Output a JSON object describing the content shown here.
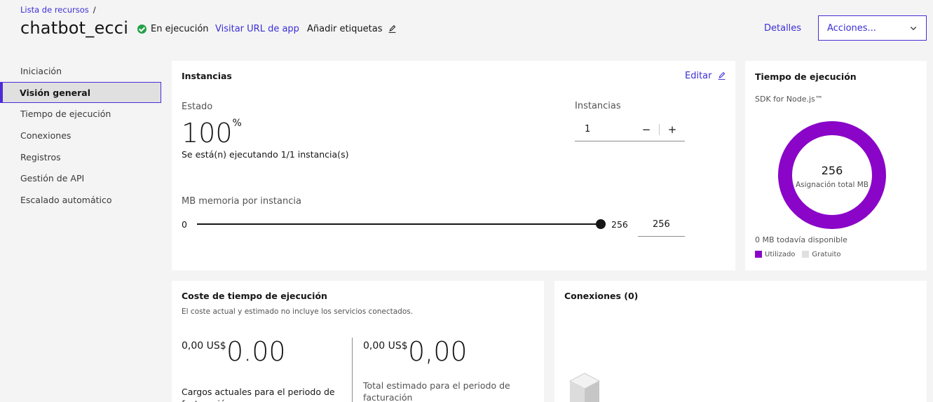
{
  "header": {
    "breadcrumb": "Lista de recursos",
    "breadcrumb_sep": "/",
    "app_name": "chatbot_ecci",
    "status": "En ejecución",
    "visit_url": "Visitar URL de app",
    "add_tags": "Añadir etiquetas",
    "details": "Detalles",
    "actions": "Acciones..."
  },
  "sidebar": {
    "items": [
      {
        "label": "Iniciación"
      },
      {
        "label": "Visión general"
      },
      {
        "label": "Tiempo de ejecución"
      },
      {
        "label": "Conexiones"
      },
      {
        "label": "Registros"
      },
      {
        "label": "Gestión de API"
      },
      {
        "label": "Escalado automático"
      }
    ],
    "active_index": 1
  },
  "instances_card": {
    "title": "Instancias",
    "edit": "Editar",
    "state_label": "Estado",
    "state_value": "100",
    "state_unit": "%",
    "state_detail": "Se está(n) ejecutando 1/1 instancia(s)",
    "instances_label": "Instancias",
    "instances_value": "1",
    "minus": "−",
    "plus": "+",
    "memory_label": "MB memoria por instancia",
    "slider_min": "0",
    "slider_max": "256",
    "slider_value": 1.0,
    "memory_value": "256"
  },
  "runtime_card": {
    "title": "Tiempo de ejecución",
    "sdk": "SDK for Node.js™",
    "donut_value": "256",
    "donut_label": "Asignación total MB",
    "available": "0 MB todavía disponible",
    "legend_used": "Utilizado",
    "legend_free": "Gratuito",
    "used_fraction": 1.0,
    "colors": {
      "used": "#8a05c8",
      "free": "#e0e0e0"
    }
  },
  "cost_card": {
    "title": "Coste de tiempo de ejecución",
    "subtitle": "El coste actual y estimado no incluye los servicios conectados.",
    "current_currency": "0,00 US$",
    "current_value": "0.00",
    "current_label": "Cargos actuales para el periodo de facturación",
    "estimated_currency": "0,00 US$",
    "estimated_value": "0,00",
    "estimated_label": "Total estimado para el periodo de facturación"
  },
  "connections_card": {
    "title": "Conexiones (0)"
  },
  "icons": {
    "status": "check-circle-icon",
    "tags": "pencil-icon",
    "edit": "pencil-icon",
    "actions": "chevron-down-icon",
    "connections": "cube-icon"
  }
}
